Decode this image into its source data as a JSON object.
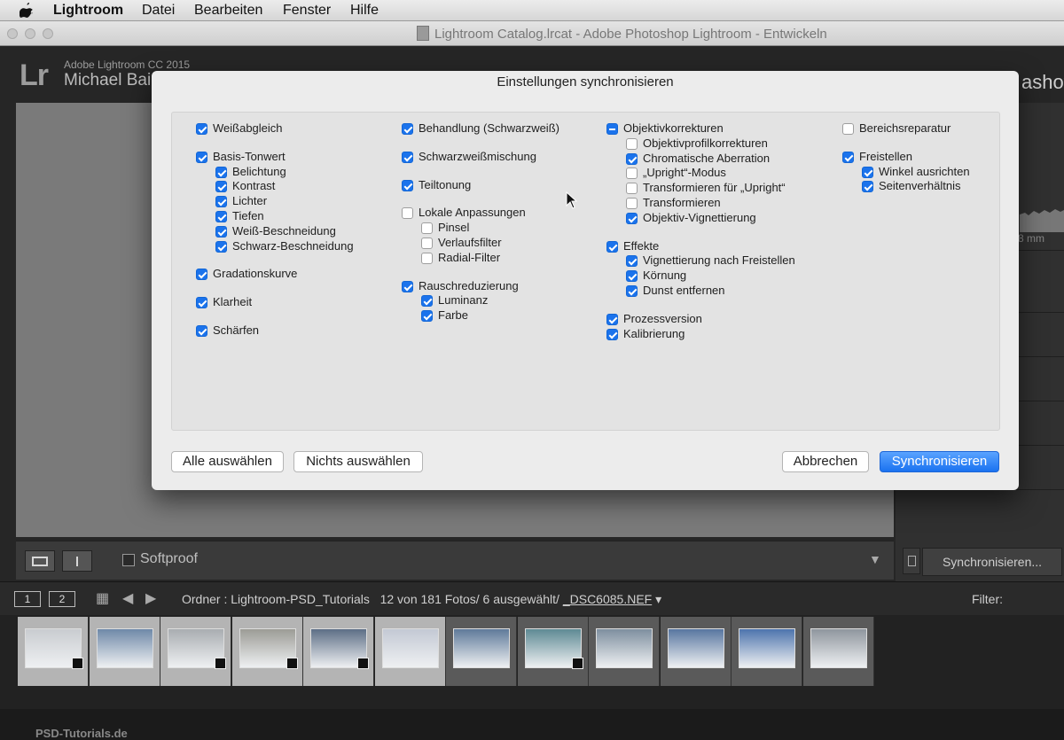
{
  "menubar": {
    "app": "Lightroom",
    "items": [
      "Datei",
      "Bearbeiten",
      "Fenster",
      "Hilfe"
    ]
  },
  "window": {
    "title": "Lightroom Catalog.lrcat - Adobe Photoshop Lightroom - Entwickeln"
  },
  "identity": {
    "logo": "Lr",
    "product": "Adobe Lightroom CC 2015",
    "user": "Michael Baie",
    "module_partial": "ashov"
  },
  "right_panel": {
    "lens_readout": "8 mm",
    "sync_button": "Synchronisieren..."
  },
  "toolbar": {
    "softproof": "Softproof",
    "softproof_checked": false
  },
  "filmbar": {
    "view1": "1",
    "view2": "2",
    "folder": "Ordner : Lightroom-PSD_Tutorials",
    "count": "12 von 181 Fotos/ 6 ausgewählt/",
    "file": "_DSC6085.NEF",
    "filter": "Filter:"
  },
  "filmstrip": {
    "thumbs": [
      {
        "selected": true,
        "color": "#c9ccd0",
        "badge": true
      },
      {
        "selected": true,
        "color": "#6f89a8",
        "badge": false
      },
      {
        "selected": true,
        "color": "#a9adb1",
        "badge": true
      },
      {
        "selected": true,
        "color": "#9c9c96",
        "badge": true
      },
      {
        "selected": true,
        "color": "#5d6f86",
        "badge": true
      },
      {
        "selected": true,
        "color": "#c3c9d4",
        "badge": false
      },
      {
        "selected": false,
        "color": "#5f7a9a",
        "badge": false
      },
      {
        "selected": false,
        "color": "#5e8a94",
        "badge": true
      },
      {
        "selected": false,
        "color": "#7e8f9f",
        "badge": false
      },
      {
        "selected": false,
        "color": "#5876a0",
        "badge": false
      },
      {
        "selected": false,
        "color": "#4d74ad",
        "badge": false
      },
      {
        "selected": false,
        "color": "#8f969e",
        "badge": false
      }
    ],
    "watermark": "PSD-Tutorials.de"
  },
  "dialog": {
    "title": "Einstellungen synchronisieren",
    "columns": [
      [
        {
          "label": "Weißabgleich",
          "state": "on",
          "indent": 0
        },
        {
          "gap": true
        },
        {
          "label": "Basis-Tonwert",
          "state": "on",
          "indent": 0
        },
        {
          "label": "Belichtung",
          "state": "on",
          "indent": 1
        },
        {
          "label": "Kontrast",
          "state": "on",
          "indent": 1
        },
        {
          "label": "Lichter",
          "state": "on",
          "indent": 1
        },
        {
          "label": "Tiefen",
          "state": "on",
          "indent": 1
        },
        {
          "label": "Weiß-Beschneidung",
          "state": "on",
          "indent": 1
        },
        {
          "label": "Schwarz-Beschneidung",
          "state": "on",
          "indent": 1
        },
        {
          "gap": true
        },
        {
          "label": "Gradationskurve",
          "state": "on",
          "indent": 0
        },
        {
          "gap": true
        },
        {
          "label": "Klarheit",
          "state": "on",
          "indent": 0
        },
        {
          "gap": true
        },
        {
          "label": "Schärfen",
          "state": "on",
          "indent": 0
        }
      ],
      [
        {
          "label": "Behandlung (Schwarzweiß)",
          "state": "on",
          "indent": 0
        },
        {
          "gap": true
        },
        {
          "label": "Schwarzweißmischung",
          "state": "on",
          "indent": 0
        },
        {
          "gap": true
        },
        {
          "label": "Teiltonung",
          "state": "on",
          "indent": 0
        },
        {
          "gap": true
        },
        {
          "label": "Lokale Anpassungen",
          "state": "off",
          "indent": 0
        },
        {
          "label": "Pinsel",
          "state": "off",
          "indent": 1
        },
        {
          "label": "Verlaufsfilter",
          "state": "off",
          "indent": 1
        },
        {
          "label": "Radial-Filter",
          "state": "off",
          "indent": 1
        },
        {
          "gap": true
        },
        {
          "label": "Rauschreduzierung",
          "state": "on",
          "indent": 0
        },
        {
          "label": "Luminanz",
          "state": "on",
          "indent": 1
        },
        {
          "label": "Farbe",
          "state": "on",
          "indent": 1
        }
      ],
      [
        {
          "label": "Objektivkorrekturen",
          "state": "mixed",
          "indent": 0
        },
        {
          "label": "Objektivprofilkorrekturen",
          "state": "off",
          "indent": 1
        },
        {
          "label": "Chromatische Aberration",
          "state": "on",
          "indent": 1
        },
        {
          "label": "„Upright“-Modus",
          "state": "off",
          "indent": 1
        },
        {
          "label": "Transformieren für „Upright“",
          "state": "off",
          "indent": 1
        },
        {
          "label": "Transformieren",
          "state": "off",
          "indent": 1
        },
        {
          "label": "Objektiv-Vignettierung",
          "state": "on",
          "indent": 1
        },
        {
          "gap": true
        },
        {
          "label": "Effekte",
          "state": "on",
          "indent": 0
        },
        {
          "label": "Vignettierung nach Freistellen",
          "state": "on",
          "indent": 1
        },
        {
          "label": "Körnung",
          "state": "on",
          "indent": 1
        },
        {
          "label": "Dunst entfernen",
          "state": "on",
          "indent": 1
        },
        {
          "gap": true
        },
        {
          "label": "Prozessversion",
          "state": "on",
          "indent": 0
        },
        {
          "label": "Kalibrierung",
          "state": "on",
          "indent": 0
        }
      ],
      [
        {
          "label": "Bereichsreparatur",
          "state": "off",
          "indent": 0
        },
        {
          "gap": true
        },
        {
          "label": "Freistellen",
          "state": "on",
          "indent": 0
        },
        {
          "label": "Winkel ausrichten",
          "state": "on",
          "indent": 1
        },
        {
          "label": "Seitenverhältnis",
          "state": "on",
          "indent": 1
        }
      ]
    ],
    "buttons": {
      "select_all": "Alle auswählen",
      "select_none": "Nichts auswählen",
      "cancel": "Abbrechen",
      "sync": "Synchronisieren"
    }
  }
}
